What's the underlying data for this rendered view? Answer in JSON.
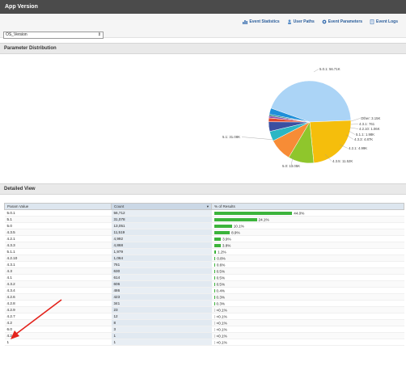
{
  "window": {
    "title": "App Version"
  },
  "toolbar": {
    "links": [
      {
        "label": "Event Statistics",
        "icon": "bar-chart-icon"
      },
      {
        "label": "User Paths",
        "icon": "user-paths-icon"
      },
      {
        "label": "Event Parameters",
        "icon": "gear-icon"
      },
      {
        "label": "Event Logs",
        "icon": "document-icon"
      }
    ],
    "select_value": "OS_Version"
  },
  "param_panel": {
    "title": "Parameter Distribution"
  },
  "detail_panel": {
    "title": "Detailed View"
  },
  "colors": {
    "accent": "#3cb43c",
    "header": "#4b4b4b",
    "link": "#2a5d9b"
  },
  "chart_data": {
    "type": "pie",
    "slices": [
      {
        "label": "5.0.1: 56.71K",
        "value": 56712,
        "color": "#abd4f6"
      },
      {
        "label": "5.1: 31.08K",
        "value": 31078,
        "color": "#f5be0c"
      },
      {
        "label": "5.0: 13.05K",
        "value": 13051,
        "color": "#8fc62c"
      },
      {
        "label": "4.3.5: 11.52K",
        "value": 11519,
        "color": "#f78c36"
      },
      {
        "label": "4.2.1: 4.99K",
        "value": 4992,
        "color": "#2bb6c4"
      },
      {
        "label": "4.3.3: 4.87K",
        "value": 4868,
        "color": "#3a4fa1"
      },
      {
        "label": "5.1.1: 1.98K",
        "value": 1979,
        "color": "#e04a2f"
      },
      {
        "label": "4.2.10: 1.06K",
        "value": 1064,
        "color": "#8c4aa6"
      },
      {
        "label": "4.3.1: 761",
        "value": 761,
        "color": "#13796e"
      },
      {
        "label": "Other: 3.15K",
        "value": 3148,
        "color": "#1f8fd9"
      }
    ]
  },
  "table": {
    "headers": [
      "Param Value",
      "Count",
      "% of Results"
    ],
    "rows": [
      {
        "value": "5.0.1",
        "count": "56,712",
        "pct": "44.0%",
        "frac": 0.44
      },
      {
        "value": "5.1",
        "count": "31,078",
        "pct": "24.1%",
        "frac": 0.241
      },
      {
        "value": "5.0",
        "count": "13,051",
        "pct": "10.1%",
        "frac": 0.101
      },
      {
        "value": "4.3.5",
        "count": "11,519",
        "pct": "8.9%",
        "frac": 0.089
      },
      {
        "value": "4.2.1",
        "count": "4,992",
        "pct": "3.9%",
        "frac": 0.039
      },
      {
        "value": "4.3.3",
        "count": "4,868",
        "pct": "3.8%",
        "frac": 0.038
      },
      {
        "value": "5.1.1",
        "count": "1,979",
        "pct": "1.2%",
        "frac": 0.012
      },
      {
        "value": "4.2.10",
        "count": "1,064",
        "pct": "0.8%",
        "frac": 0.008
      },
      {
        "value": "4.3.1",
        "count": "761",
        "pct": "0.6%",
        "frac": 0.006
      },
      {
        "value": "4.3",
        "count": "630",
        "pct": "0.5%",
        "frac": 0.005
      },
      {
        "value": "4.1",
        "count": "614",
        "pct": "0.5%",
        "frac": 0.005
      },
      {
        "value": "4.3.2",
        "count": "606",
        "pct": "0.5%",
        "frac": 0.005
      },
      {
        "value": "4.3.4",
        "count": "486",
        "pct": "0.4%",
        "frac": 0.004
      },
      {
        "value": "4.2.6",
        "count": "423",
        "pct": "0.3%",
        "frac": 0.003
      },
      {
        "value": "4.2.8",
        "count": "341",
        "pct": "0.3%",
        "frac": 0.003
      },
      {
        "value": "4.2.9",
        "count": "23",
        "pct": "<0.1%",
        "frac": 0
      },
      {
        "value": "4.2.7",
        "count": "12",
        "pct": "<0.1%",
        "frac": 0
      },
      {
        "value": "4.2",
        "count": "8",
        "pct": "<0.1%",
        "frac": 0
      },
      {
        "value": "6.0",
        "count": "3",
        "pct": "<0.1%",
        "frac": 0
      },
      {
        "value": "4.2.5",
        "count": "1",
        "pct": "<0.1%",
        "frac": 0
      },
      {
        "value": "1",
        "count": "1",
        "pct": "<0.1%",
        "frac": 0
      }
    ]
  }
}
